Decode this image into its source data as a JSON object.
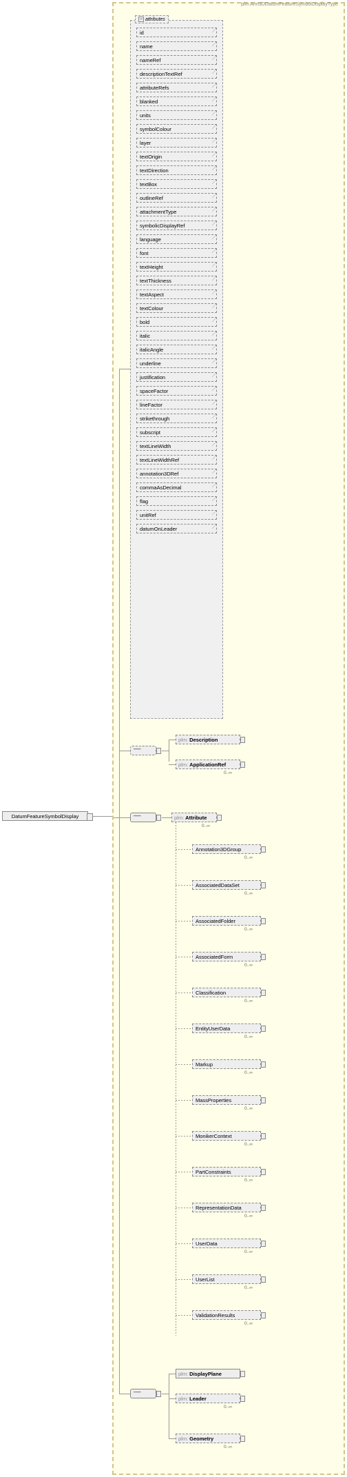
{
  "root": {
    "label": "DatumFeatureSymbolDisplay"
  },
  "type_label": "plm:Ann3DDatumFeatureSymbolDisplayType",
  "attr_header": "attributes",
  "attributes": [
    "id",
    "name",
    "nameRef",
    "descriptionTextRef",
    "attributeRefs",
    "blanked",
    "units",
    "symbolColour",
    "layer",
    "textOrigin",
    "textDirection",
    "textBox",
    "outlineRef",
    "attachmentType",
    "symbolicDisplayRef",
    "language",
    "font",
    "textHeight",
    "textThickness",
    "textAspect",
    "textColour",
    "bold",
    "italic",
    "italicAngle",
    "underline",
    "justification",
    "spaceFactor",
    "lineFactor",
    "strikethrough",
    "subscript",
    "textLineWidth",
    "textLineWidthRef",
    "annotation3DRef",
    "commaAsDecimal",
    "flag",
    "unitRef",
    "datumOnLeader"
  ],
  "groupA": [
    {
      "prefix": "plm:",
      "name": "Description"
    },
    {
      "prefix": "plm:",
      "name": "ApplicationRef",
      "card": "0..∞"
    }
  ],
  "attribute_el": {
    "prefix": "plm:",
    "name": "Attribute",
    "card": "0..∞"
  },
  "subst": [
    {
      "name": "Annotation3DGroup",
      "card": "0..∞"
    },
    {
      "name": "AssociatedDataSet",
      "card": "0..∞"
    },
    {
      "name": "AssociatedFolder",
      "card": "0..∞"
    },
    {
      "name": "AssociatedForm",
      "card": "0..∞"
    },
    {
      "name": "Classification",
      "card": "0..∞"
    },
    {
      "name": "EntityUserData",
      "card": "0..∞"
    },
    {
      "name": "Markup",
      "card": "0..∞"
    },
    {
      "name": "MassProperties",
      "card": "0..∞"
    },
    {
      "name": "MonikerContext",
      "card": "0..∞"
    },
    {
      "name": "PartConstraints",
      "card": "0..∞"
    },
    {
      "name": "RepresentationData",
      "card": "0..∞"
    },
    {
      "name": "UserData",
      "card": "0..∞"
    },
    {
      "name": "UserList",
      "card": "0..∞"
    },
    {
      "name": "ValidationResults",
      "card": "0..∞"
    }
  ],
  "groupB": [
    {
      "prefix": "plm:",
      "name": "DisplayPlane"
    },
    {
      "prefix": "plm:",
      "name": "Leader",
      "card": "0..∞"
    },
    {
      "prefix": "plm:",
      "name": "Geometry",
      "card": "0..∞"
    }
  ],
  "chart_data": {
    "type": "tree",
    "note": "XML schema structure diagram"
  }
}
